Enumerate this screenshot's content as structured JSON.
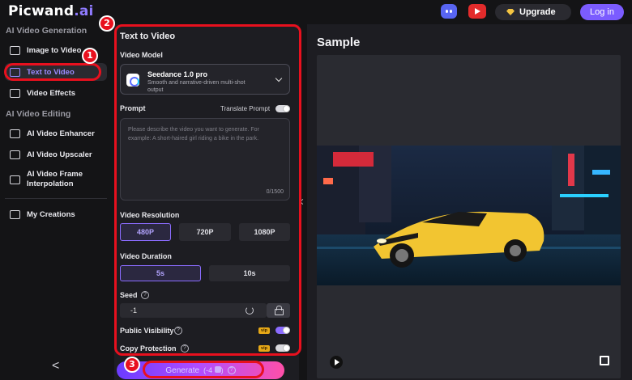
{
  "header": {
    "logo_main": "Picwand",
    "logo_ext": ".ai",
    "upgrade_label": "Upgrade",
    "login_label": "Log in"
  },
  "sidebar": {
    "sections": [
      {
        "title": "AI Video Generation"
      },
      {
        "title": "AI Video Editing"
      }
    ],
    "items": [
      {
        "label": "Image to Video",
        "icon": "image-icon"
      },
      {
        "label": "Text to Video",
        "icon": "text-video-icon",
        "active": true
      },
      {
        "label": "Video Effects",
        "icon": "sparkle-icon"
      },
      {
        "label": "AI Video Enhancer",
        "icon": "enhancer-icon"
      },
      {
        "label": "AI Video Upscaler",
        "icon": "upscaler-icon"
      },
      {
        "label": "AI Video Frame Interpolation",
        "icon": "frame-icon"
      },
      {
        "label": "My Creations",
        "icon": "folder-icon"
      }
    ],
    "collapse_glyph": "<"
  },
  "panel": {
    "title": "Text to Video",
    "model_label": "Video Model",
    "model_name": "Seedance 1.0 pro",
    "model_desc": "Smooth and narrative-driven multi-shot output",
    "prompt_label": "Prompt",
    "translate_label": "Translate Prompt",
    "prompt_placeholder": "Please describe the video you want to generate. For example: A short-haired girl riding a bike in the park.",
    "prompt_counter": "0/1500",
    "resolution_label": "Video Resolution",
    "resolutions": [
      "480P",
      "720P",
      "1080P"
    ],
    "resolution_selected": "480P",
    "duration_label": "Video Duration",
    "durations": [
      "5s",
      "10s"
    ],
    "duration_selected": "5s",
    "seed_label": "Seed",
    "seed_value": "-1",
    "public_label": "Public Visibility",
    "public_on": true,
    "copy_label": "Copy Protection",
    "copy_on": false,
    "vip_badge": "vip",
    "generate_label": "Generate",
    "generate_cost": "(-4",
    "generate_cost_end": ")",
    "help_glyph": "?"
  },
  "sample": {
    "title": "Sample"
  },
  "annotations": {
    "one": "1",
    "two": "2",
    "three": "3",
    "color": "#e8101e"
  },
  "colors": {
    "accent": "#8b6cff",
    "background": "#141416",
    "panel": "#1d1d22"
  }
}
